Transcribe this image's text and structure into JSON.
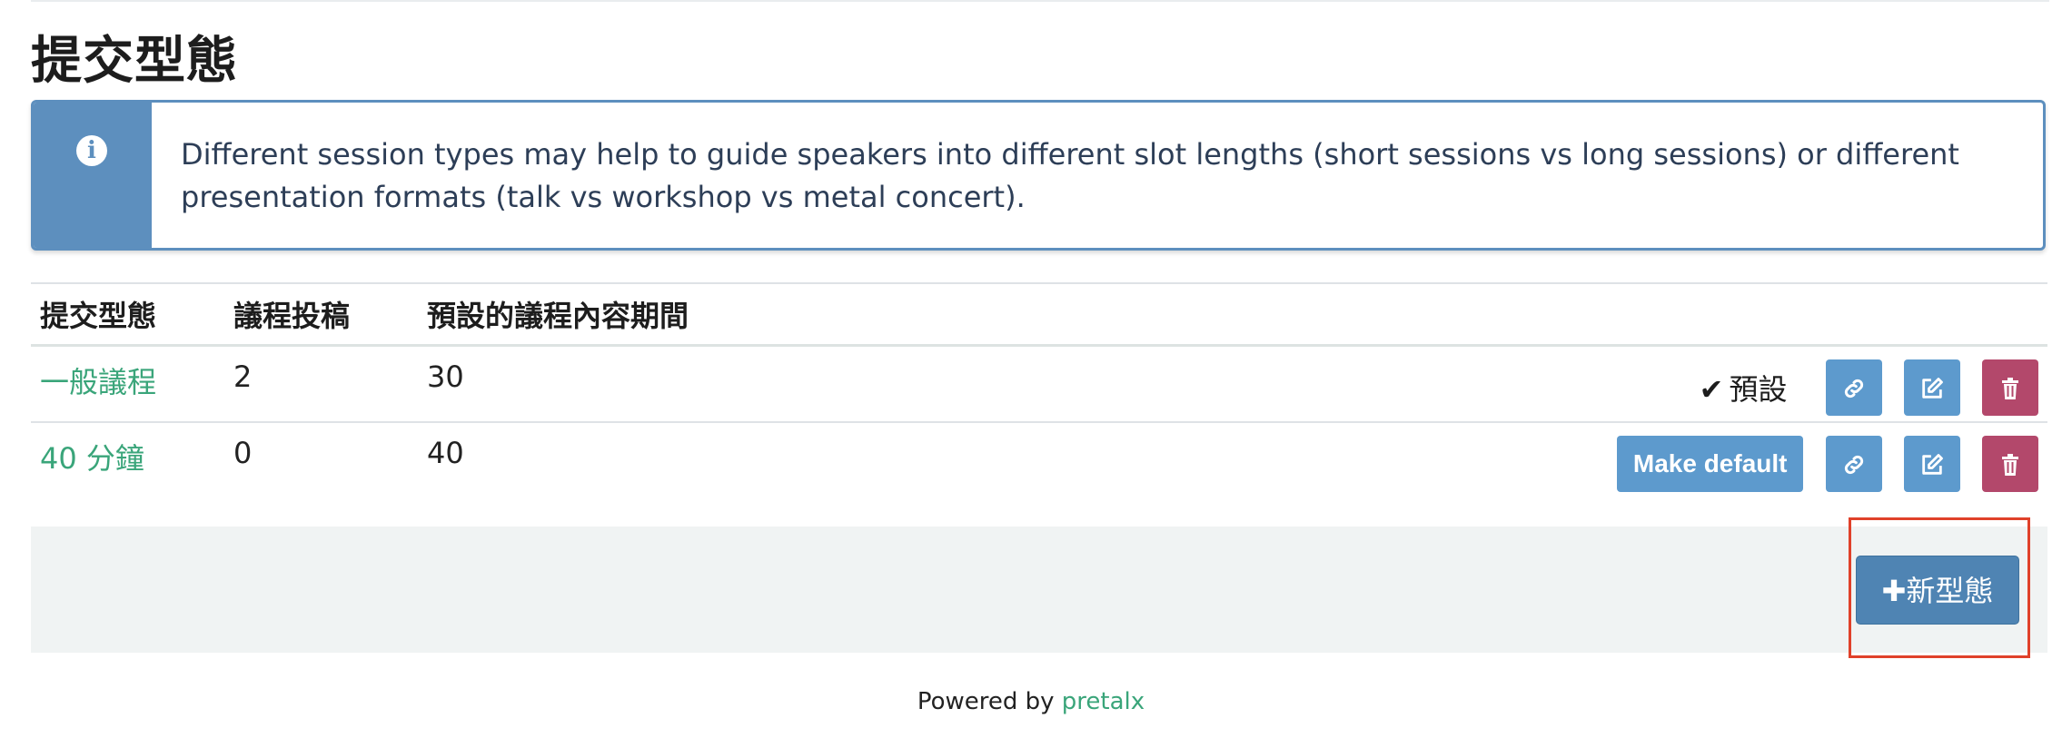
{
  "page": {
    "title": "提交型態"
  },
  "alert": {
    "icon": "info-icon",
    "text": "Different session types may help to guide speakers into different slot lengths (short sessions vs long sessions) or different presentation formats (talk vs workshop vs metal concert)."
  },
  "table": {
    "headers": [
      "提交型態",
      "議程投稿",
      "預設的議程內容期間"
    ],
    "rows": [
      {
        "name": "一般議程",
        "submissions": "2",
        "duration": "30",
        "is_default": true,
        "default_label": "預設"
      },
      {
        "name": "40 分鐘",
        "submissions": "0",
        "duration": "40",
        "is_default": false,
        "make_default_label": "Make default"
      }
    ]
  },
  "new_button": {
    "label": "新型態",
    "icon": "plus-icon"
  },
  "footer": {
    "powered_by": "Powered by",
    "brand": "pretalx"
  },
  "colors": {
    "accent_blue": "#5d9acd",
    "danger": "#b3486b",
    "link_green": "#3aa57a",
    "alert_blue": "#5d8fbe",
    "highlight": "#e0412a"
  }
}
